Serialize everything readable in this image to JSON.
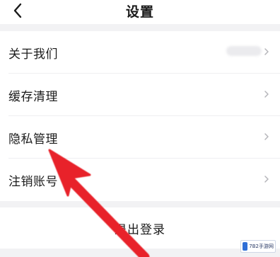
{
  "header": {
    "title": "设置",
    "back_icon": "chevron-left-icon"
  },
  "settings": {
    "items": [
      {
        "label": "关于我们",
        "icon": "chevron-right-icon"
      },
      {
        "label": "缓存清理",
        "icon": "chevron-right-icon"
      },
      {
        "label": "隐私管理",
        "icon": "chevron-right-icon"
      },
      {
        "label": "注销账号",
        "icon": "chevron-right-icon"
      }
    ]
  },
  "logout": {
    "label": "退出登录"
  },
  "annotation": {
    "color": "#e8202a",
    "icon": "red-arrow-icon"
  },
  "watermark": {
    "text": "7B2手游网"
  },
  "colors": {
    "background": "#f2f2f4",
    "surface": "#ffffff",
    "text": "#1c1c1c",
    "chevron": "#b5b5ba"
  }
}
